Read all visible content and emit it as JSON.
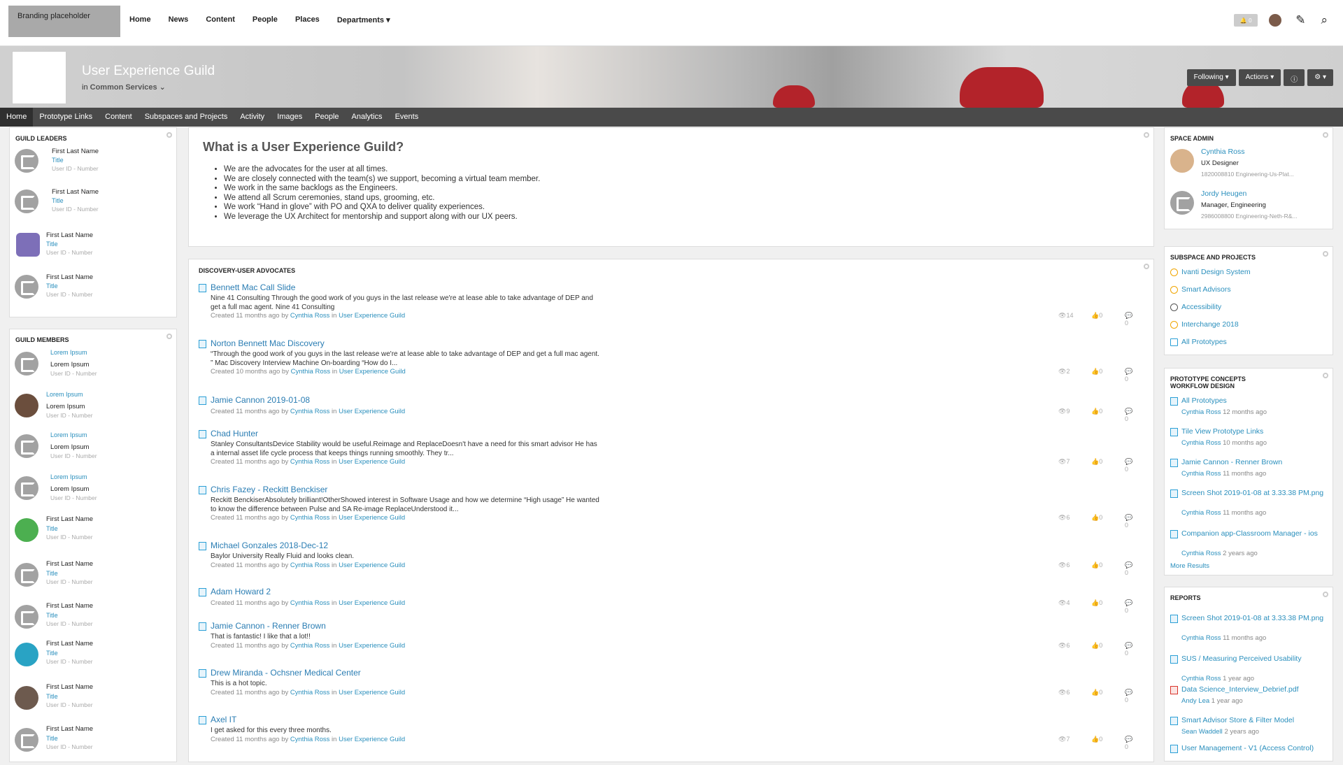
{
  "branding": "Branding placeholder",
  "nav": [
    "Home",
    "News",
    "Content",
    "People",
    "Places",
    "Departments ▾"
  ],
  "notif_count": "0",
  "space": {
    "title": "User Experience Guild",
    "in_label": "in",
    "parent": "Common Services"
  },
  "banner_buttons": [
    "Following ▾",
    "Actions ▾",
    "ⓘ",
    "⚙ ▾"
  ],
  "subnav": [
    "Home",
    "Prototype Links",
    "Content",
    "Subspaces and Projects",
    "Activity",
    "Images",
    "People",
    "Analytics",
    "Events"
  ],
  "leaders": {
    "header": "GUILD LEADERS",
    "items": [
      {
        "name": "First Last Name",
        "title": "Title",
        "id": "User ID - Number"
      },
      {
        "name": "First Last Name",
        "title": "Title",
        "id": "User ID - Number"
      },
      {
        "name": "First Last Name",
        "title": "Title",
        "id": "User ID - Number"
      },
      {
        "name": "First Last Name",
        "title": "Title",
        "id": "User ID - Number"
      }
    ]
  },
  "members": {
    "header": "GUILD MEMBERS",
    "items": [
      {
        "name": "Lorem Ipsum",
        "title": "Lorem Ipsum",
        "id": "User ID - Number"
      },
      {
        "name": "Lorem Ipsum",
        "title": "Lorem Ipsum",
        "id": "User ID - Number"
      },
      {
        "name": "Lorem Ipsum",
        "title": "Lorem Ipsum",
        "id": "User ID - Number"
      },
      {
        "name": "Lorem Ipsum",
        "title": "Lorem Ipsum",
        "id": "User ID - Number"
      },
      {
        "name": "First Last Name",
        "title": "Title",
        "id": "User ID - Number"
      },
      {
        "name": "First Last Name",
        "title": "Title",
        "id": "User ID - Number"
      },
      {
        "name": "First Last Name",
        "title": "Title",
        "id": "User ID - Number"
      },
      {
        "name": "First Last Name",
        "title": "Title",
        "id": "User ID - Number"
      },
      {
        "name": "First Last Name",
        "title": "Title",
        "id": "User ID - Number"
      },
      {
        "name": "First Last Name",
        "title": "Title",
        "id": "User ID - Number"
      }
    ]
  },
  "about": {
    "heading": "What is a User Experience Guild?",
    "bullets": [
      "We are the advocates for the user at all times.",
      "We are closely connected with the team(s) we support, becoming a virtual team member.",
      "We work in the same backlogs as the Engineers.",
      "We attend all Scrum ceremonies, stand ups, grooming, etc.",
      "We work “Hand in glove” with PO and QXA to deliver quality experiences.",
      "We leverage the UX Architect for mentorship and support along with our UX peers."
    ]
  },
  "feed": {
    "header": "DISCOVERY-USER ADVOCATES",
    "posts": [
      {
        "title": "Bennett Mac Call Slide",
        "body": "Nine 41 Consulting Through the good work of you guys in the last release we're at lease able to take advantage of DEP and get a full mac agent. Nine 41 Consulting",
        "created": "Created 11 months ago by",
        "author": "Cynthia Ross",
        "in": "in",
        "place": "User Experience Guild",
        "views": "14",
        "likes": "0",
        "comments": "0"
      },
      {
        "title": "Norton Bennett Mac Discovery",
        "body": "“Through the good work of you guys in the last release we're at lease able to take advantage of DEP and get a full mac agent. ” Mac Discovery Interview Machine On-boarding “How do I...",
        "created": "Created 10 months ago by",
        "author": "Cynthia Ross",
        "in": "in",
        "place": "User Experience Guild",
        "views": "2",
        "likes": "0",
        "comments": "0"
      },
      {
        "title": "Jamie Cannon  2019-01-08",
        "body": "",
        "created": "Created 11 months ago by",
        "author": "Cynthia Ross",
        "in": "in",
        "place": "User Experience Guild",
        "views": "9",
        "likes": "0",
        "comments": "0"
      },
      {
        "title": "Chad Hunter",
        "body": "Stanley ConsultantsDevice Stability would be useful.Reimage and ReplaceDoesn't have a need for this smart advisor He has a internal asset life cycle process that keeps things running smoothly. They tr...",
        "created": "Created 11 months ago by",
        "author": "Cynthia Ross",
        "in": "in",
        "place": "User Experience Guild",
        "views": "7",
        "likes": "0",
        "comments": "0"
      },
      {
        "title": "Chris Fazey - Reckitt Benckiser",
        "body": "Reckitt BenckiserAbsolutely brilliant!OtherShowed interest in Software Usage and how we determine “High usage” He wanted to know the difference between Pulse and SA Re-image ReplaceUnderstood it...",
        "created": "Created 11 months ago by",
        "author": "Cynthia Ross",
        "in": "in",
        "place": "User Experience Guild",
        "views": "6",
        "likes": "0",
        "comments": "0"
      },
      {
        "title": "Michael Gonzales 2018-Dec-12",
        "body": "Baylor University Really Fluid and looks clean.",
        "created": "Created 11 months ago by",
        "author": "Cynthia Ross",
        "in": "in",
        "place": "User Experience Guild",
        "views": "6",
        "likes": "0",
        "comments": "0"
      },
      {
        "title": "Adam Howard 2",
        "body": "",
        "created": "Created 11 months ago by",
        "author": "Cynthia Ross",
        "in": "in",
        "place": "User Experience Guild",
        "views": "4",
        "likes": "0",
        "comments": "0"
      },
      {
        "title": "Jamie Cannon - Renner Brown",
        "body": "That is fantastic! I like that a lot!!",
        "created": "Created 11 months ago by",
        "author": "Cynthia Ross",
        "in": "in",
        "place": "User Experience Guild",
        "views": "6",
        "likes": "0",
        "comments": "0"
      },
      {
        "title": "Drew Miranda - Ochsner Medical Center",
        "body": "This is a hot topic.",
        "created": "Created 11 months ago by",
        "author": "Cynthia Ross",
        "in": "in",
        "place": "User Experience Guild",
        "views": "6",
        "likes": "0",
        "comments": "0"
      },
      {
        "title": "Axel IT",
        "body": "I get asked for this every three months.",
        "created": "Created 11 months ago by",
        "author": "Cynthia Ross",
        "in": "in",
        "place": "User Experience Guild",
        "views": "7",
        "likes": "0",
        "comments": "0"
      }
    ]
  },
  "admin": {
    "header": "SPACE ADMIN",
    "items": [
      {
        "name": "Cynthia Ross",
        "role": "UX Designer",
        "detail": "1820008810 Engineering-Us-Plat..."
      },
      {
        "name": "Jordy Heugen",
        "role": "Manager, Engineering",
        "detail": "2986008800 Engineering-Neth-R&..."
      }
    ]
  },
  "subspaces": {
    "header": "SUBSPACE AND PROJECTS",
    "items": [
      "Ivanti Design System",
      "Smart Advisors",
      "Accessibility",
      "Interchange 2018",
      "All Prototypes"
    ]
  },
  "concepts": {
    "header1": "PROTOTYPE CONCEPTS",
    "header2": "WORKFLOW DESIGN",
    "items": [
      {
        "title": "All Prototypes",
        "author": "Cynthia Ross",
        "when": "12 months ago"
      },
      {
        "title": "Tile View Prototype Links",
        "author": "Cynthia Ross",
        "when": "10 months ago"
      },
      {
        "title": "Jamie Cannon - Renner Brown",
        "author": "Cynthia Ross",
        "when": "11 months ago"
      },
      {
        "title": "Screen Shot 2019-01-08 at 3.33.38 PM.png",
        "author": "Cynthia Ross",
        "when": "11 months ago"
      },
      {
        "title": "Companion app-Classroom Manager - ios",
        "author": "Cynthia Ross",
        "when": "2 years ago"
      }
    ],
    "more": "More Results"
  },
  "reports": {
    "header": "REPORTS",
    "items": [
      {
        "title": "Screen Shot 2019-01-08 at 3.33.38 PM.png",
        "author": "Cynthia Ross",
        "when": "11 months ago"
      },
      {
        "title": "SUS / Measuring Perceived Usability",
        "author": "Cynthia Ross",
        "when": "1 year ago"
      },
      {
        "title": "Data Science_Interview_Debrief.pdf",
        "author": "Andy Lea",
        "when": "1 year ago"
      },
      {
        "title": "Smart Advisor Store & Filter Model",
        "author": "Sean Waddell",
        "when": "2 years ago"
      },
      {
        "title": "User Management - V1 (Access Control)",
        "author": "",
        "when": ""
      }
    ]
  }
}
